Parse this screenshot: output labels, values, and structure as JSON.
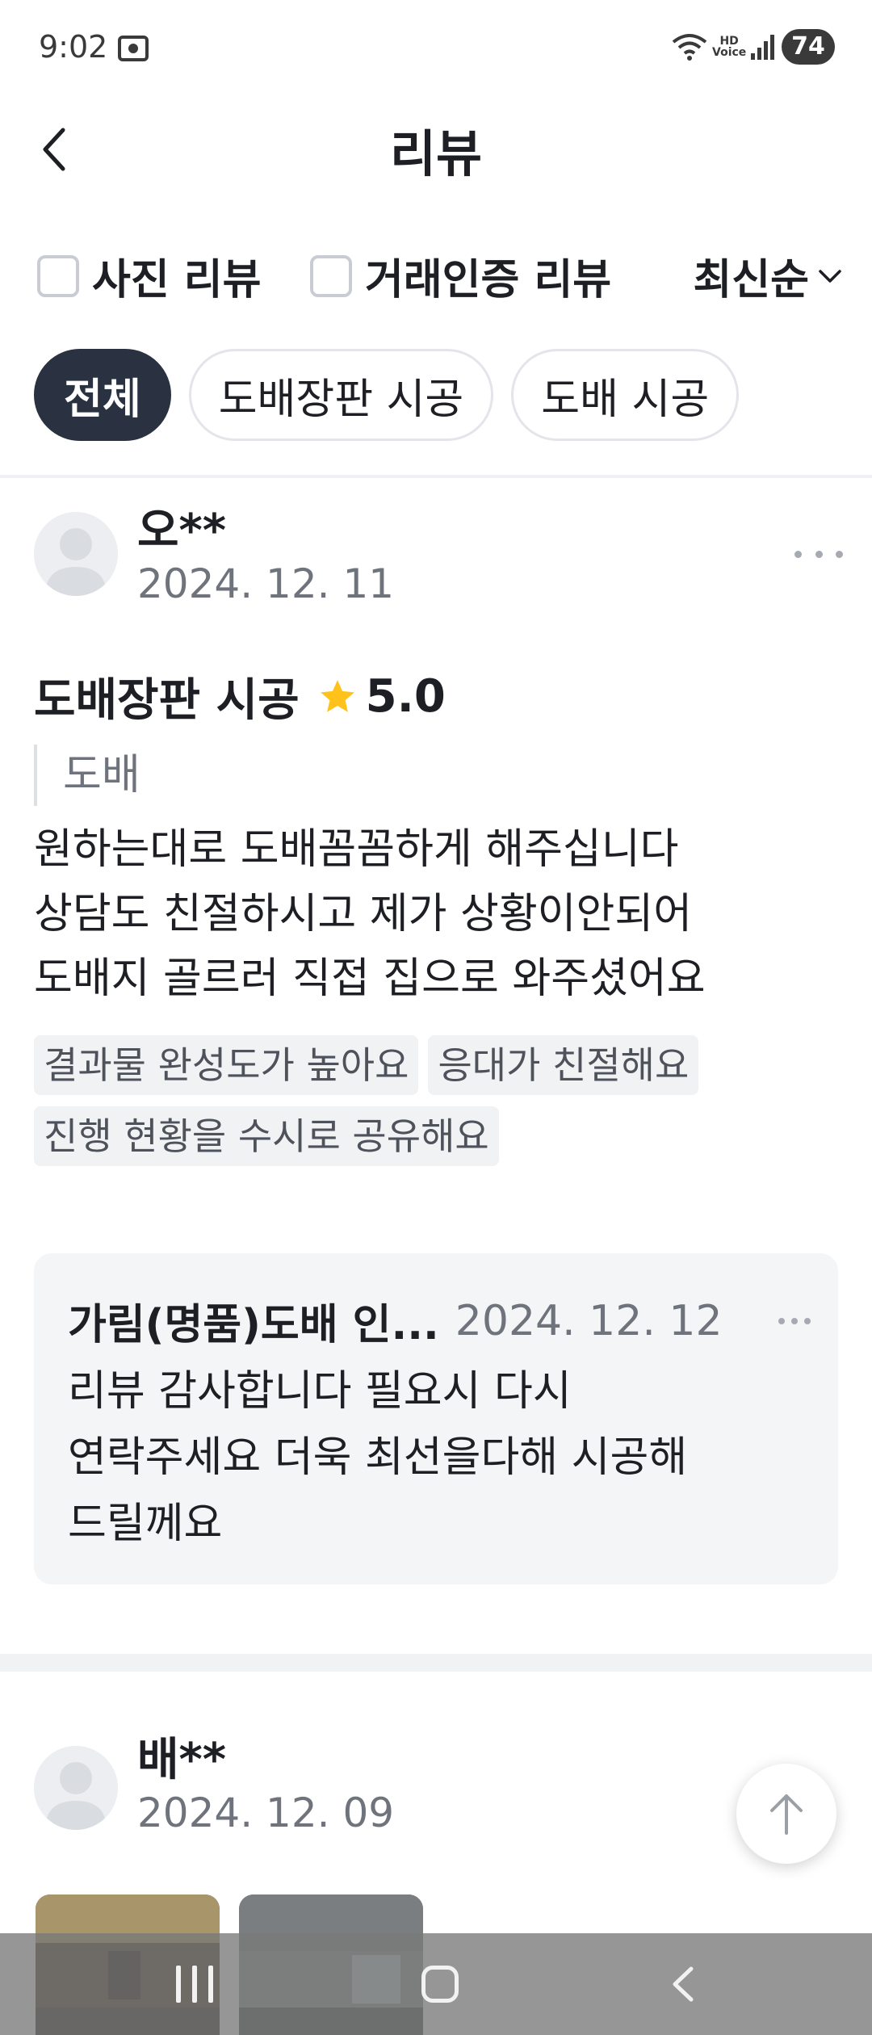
{
  "status_bar": {
    "time": "9:02",
    "battery": "74",
    "hd_label": "HD",
    "voice_label": "Voice"
  },
  "header": {
    "title": "리뷰",
    "back_icon": "chevron-left-icon"
  },
  "filters": {
    "photo_review": "사진 리뷰",
    "verified_review": "거래인증 리뷰",
    "sort": "최신순"
  },
  "chips": [
    "전체",
    "도배장판 시공",
    "도배 시공"
  ],
  "reviews": [
    {
      "name": "오**",
      "date": "2024. 12. 11",
      "service": "도배장판 시공",
      "rating": "5.0",
      "subcategory": "도배",
      "text": [
        "원하는대로 도배꼼꼼하게 해주십니다",
        "상담도 친절하시고 제가 상황이안되어",
        "도배지 골르러 직접 집으로 와주셨어요"
      ],
      "tags": [
        "결과물 완성도가 높아요",
        "응대가 친절해요",
        "진행 현황을 수시로 공유해요"
      ],
      "reply": {
        "author": "가림(명품)도배 인...",
        "date": "2024. 12. 12",
        "text": [
          "리뷰 감사합니다 필요시 다시",
          "연락주세요 더욱 최선을다해 시공해",
          "드릴께요"
        ]
      }
    },
    {
      "name": "배**",
      "date": "2024. 12. 09"
    }
  ],
  "colors": {
    "active_chip": "#2a3241",
    "star": "#ffc21a",
    "tag_bg": "#f1f2f4",
    "reply_bg": "#f4f5f7"
  }
}
